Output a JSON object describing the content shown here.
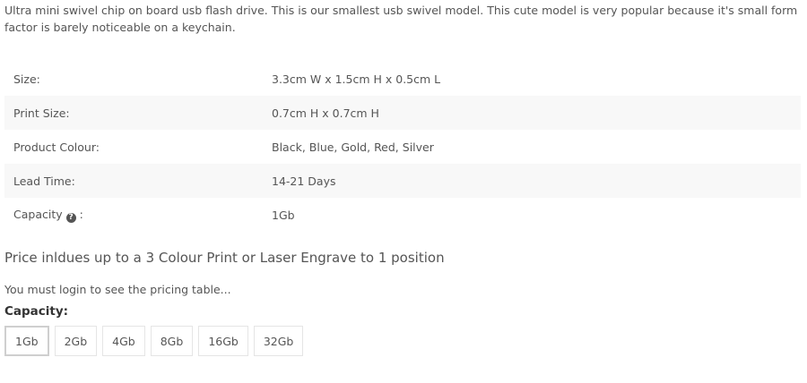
{
  "description": "Ultra mini swivel chip on board usb flash drive. This is our smallest usb swivel model. This cute model is very popular because it's small form factor is barely noticeable on a keychain.",
  "specs": [
    {
      "key": "Size:",
      "value": "3.3cm W x 1.5cm H x 0.5cm L"
    },
    {
      "key": "Print Size:",
      "value": "0.7cm H x 0.7cm H"
    },
    {
      "key": "Product Colour:",
      "value": "Black, Blue, Gold, Red, Silver"
    },
    {
      "key": "Lead Time:",
      "value": "14-21 Days"
    },
    {
      "key": "Capacity",
      "value": "1Gb",
      "key_suffix": ":",
      "icon": "question-circle-icon"
    }
  ],
  "price_note": "Price inldues up to a 3 Colour Print or Laser Engrave to 1 position",
  "login_message": "You must login to see the pricing table...",
  "capacity": {
    "label": "Capacity:",
    "selected": "1Gb",
    "options": [
      "1Gb",
      "2Gb",
      "4Gb",
      "8Gb",
      "16Gb",
      "32Gb"
    ]
  }
}
